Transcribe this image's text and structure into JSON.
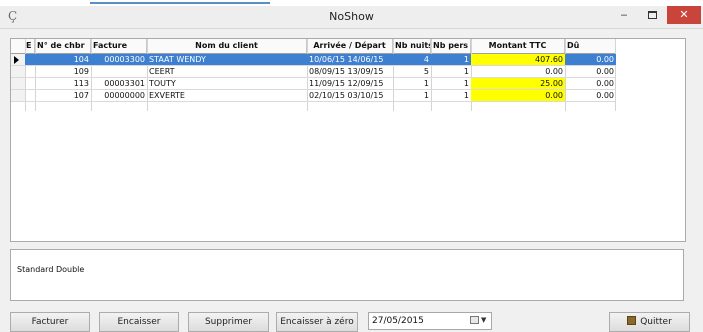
{
  "window": {
    "title": "NoShow",
    "minimize_glyph": "‒",
    "close_glyph": "✕",
    "accent_color": "#3d7fd0",
    "highlight_color": "#ffff00",
    "close_color": "#c9453b"
  },
  "app_icon_glyph": "Ç",
  "table": {
    "columns": [
      "E",
      "N° de chbr",
      "Facture",
      "Nom du client",
      "Arrivée / Départ",
      "Nb nuits",
      "Nb pers",
      "Montant TTC",
      "Dû"
    ],
    "rows": [
      {
        "room": "104",
        "facture": "00003300",
        "client": "STAAT WENDY",
        "dates": "10/06/15 14/06/15",
        "nuits": "4",
        "pers": "1",
        "montant": "407.60",
        "du": "0.00",
        "selected": true,
        "montant_highlight": true
      },
      {
        "room": "109",
        "facture": "",
        "client": "CEERT",
        "dates": "08/09/15 13/09/15",
        "nuits": "5",
        "pers": "1",
        "montant": "0.00",
        "du": "0.00",
        "selected": false,
        "montant_highlight": false
      },
      {
        "room": "113",
        "facture": "00003301",
        "client": "TOUTY",
        "dates": "11/09/15 12/09/15",
        "nuits": "1",
        "pers": "1",
        "montant": "25.00",
        "du": "0.00",
        "selected": false,
        "montant_highlight": true
      },
      {
        "room": "107",
        "facture": "00000000",
        "client": "EXVERTE",
        "dates": "02/10/15 03/10/15",
        "nuits": "1",
        "pers": "1",
        "montant": "0.00",
        "du": "0.00",
        "selected": false,
        "montant_highlight": true
      }
    ]
  },
  "memo_text": "Standard Double",
  "buttons": {
    "facturer": "Facturer",
    "encaisser": "Encaisser",
    "supprimer": "Supprimer",
    "encaisser_zero": "Encaisser à zéro",
    "quitter": "Quitter"
  },
  "date_value": "27/05/2015",
  "dropdown_glyph": "▼"
}
